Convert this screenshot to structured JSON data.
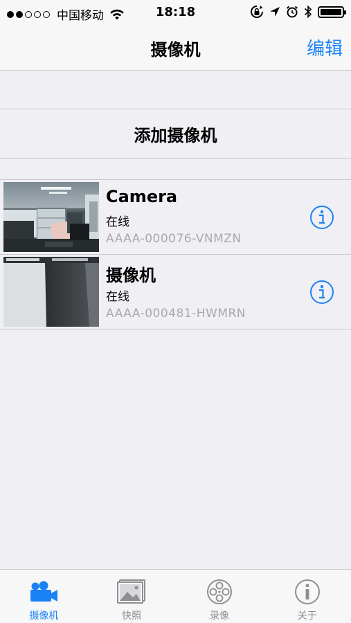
{
  "status_bar": {
    "carrier": "中国移动",
    "time": "18:18"
  },
  "nav": {
    "title": "摄像机",
    "edit_label": "编辑"
  },
  "add_camera_label": "添加摄像机",
  "cameras": [
    {
      "name": "Camera",
      "status": "在线",
      "id": "AAAA-000076-VNMZN"
    },
    {
      "name": "摄像机",
      "status": "在线",
      "id": "AAAA-000481-HWMRN"
    }
  ],
  "tabs": [
    {
      "label": "摄像机",
      "icon": "video-camera-icon",
      "active": true
    },
    {
      "label": "快照",
      "icon": "photo-icon",
      "active": false
    },
    {
      "label": "录像",
      "icon": "film-reel-icon",
      "active": false
    },
    {
      "label": "关于",
      "icon": "info-icon",
      "active": false
    }
  ],
  "colors": {
    "accent": "#1a82f5",
    "background": "#efeff4",
    "bar": "#f7f7f7",
    "separator": "#c8c7cc",
    "secondary_text": "#a8a8ad",
    "inactive_tab": "#8e8e93"
  }
}
